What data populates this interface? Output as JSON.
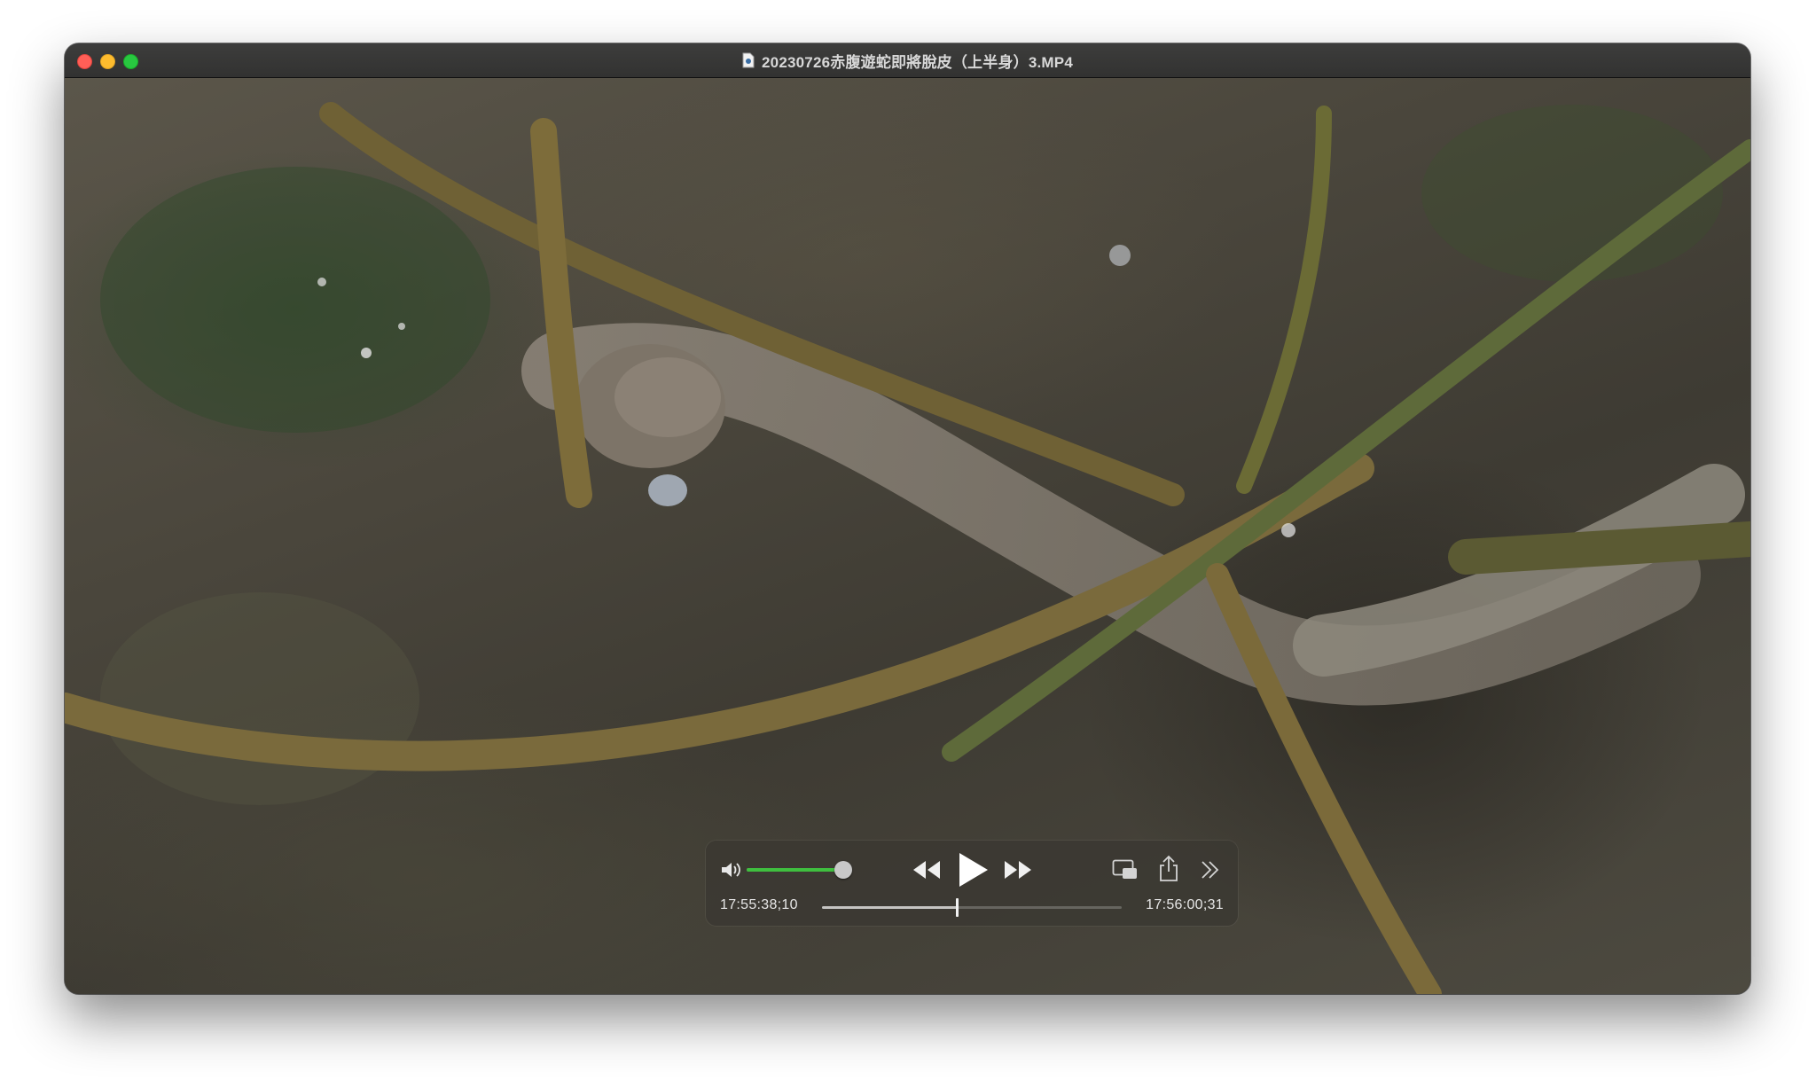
{
  "window": {
    "title": "20230726赤腹遊蛇即將脫皮（上半身）3.MP4",
    "title_icon": "document-icon"
  },
  "traffic_lights": {
    "close_color": "#ff5f57",
    "minimize_color": "#febc2e",
    "maximize_color": "#28c840"
  },
  "player": {
    "current_time": "17:55:38;10",
    "end_time": "17:56:00;31",
    "playhead_fraction": 0.45,
    "volume_fraction": 0.92,
    "volume_color": "#3fbf3f",
    "state": "paused",
    "icons": {
      "volume": "speaker-icon",
      "rewind": "rewind-icon",
      "play": "play-icon",
      "fast_forward": "fast-forward-icon",
      "pip": "picture-in-picture-icon",
      "share": "share-icon",
      "more": "chevron-double-right-icon"
    }
  }
}
